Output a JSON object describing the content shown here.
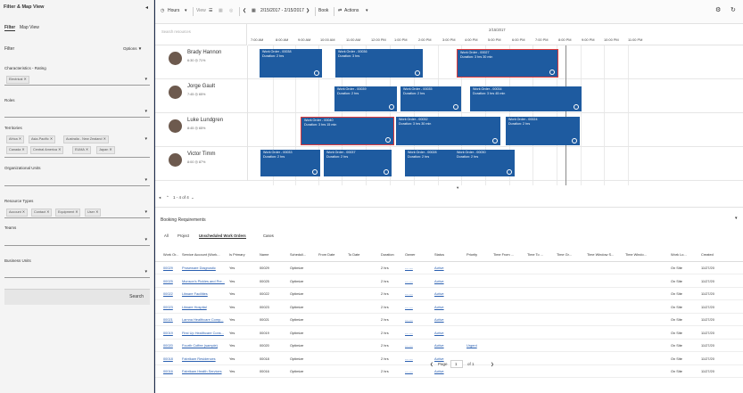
{
  "left_panel": {
    "title": "Filter & Map View",
    "collapse_icon": "chevron-left-icon",
    "tabs": [
      "Filter",
      "Map View"
    ],
    "filter_heading": "Filter",
    "options_label": "Options ▼",
    "characteristics_label": "Characteristics - Rating",
    "characteristics_chips": [
      "Electrical ✕"
    ],
    "roles_label": "Roles",
    "territories_label": "Territories",
    "territories_chips_row1": [
      "Africa ✕",
      "Asia-Pacific ✕",
      "Australia - New Zealand ✕"
    ],
    "territories_chips_row2": [
      "Canada ✕",
      "Central America ✕",
      "EUMA ✕",
      "Japan ✕"
    ],
    "org_units_label": "Organizational Units",
    "resource_types_label": "Resource Types",
    "resource_types_chips": [
      "Account ✕",
      "Contact ✕",
      "Equipment ✕",
      "User ✕"
    ],
    "teams_label": "Teams",
    "business_units_label": "Business Units",
    "search_button": "Search"
  },
  "toolbar": {
    "hours_label": "Hours",
    "view_label": "View",
    "date_range": "2/15/2017 - 2/15/2017",
    "book_label": "Book",
    "actions_label": "Actions"
  },
  "schedule": {
    "search_placeholder": "Search resources",
    "date": "2/15/2017",
    "hours": [
      "7:00 AM",
      "8:00 AM",
      "9:00 AM",
      "10:00 AM",
      "11:00 AM",
      "12:00 PM",
      "1:00 PM",
      "2:00 PM",
      "3:00 PM",
      "4:00 PM",
      "5:00 PM",
      "6:00 PM",
      "7:00 PM",
      "8:00 PM",
      "9:00 PM",
      "10:00 PM",
      "11:00 PM"
    ],
    "resources": [
      {
        "name": "Brady Hannon",
        "sub": "6:30 ◎    71%"
      },
      {
        "name": "Jorge Gault",
        "sub": "7:45 ◎    65%"
      },
      {
        "name": "Luke Lundgren",
        "sub": "8:45 ◎    65%"
      },
      {
        "name": "Victor Timm",
        "sub": "8:00 ◎    87%"
      }
    ],
    "bookings": [
      {
        "row": 0,
        "title": "Work Order - 00038",
        "dur": "Duration: 2 hrs"
      },
      {
        "row": 0,
        "title": "Work Order - 00036",
        "dur": "Duration: 3 hrs"
      },
      {
        "row": 0,
        "title": "Work Order - 00027",
        "dur": "Duration: 3 hrs 30 min"
      },
      {
        "row": 1,
        "title": "Work Order - 00039",
        "dur": "Duration: 2 hrs"
      },
      {
        "row": 1,
        "title": "Work Order - 00035",
        "dur": "Duration: 2 hrs"
      },
      {
        "row": 1,
        "title": "Work Order - 00034",
        "dur": "Duration: 3 hrs 45 min"
      },
      {
        "row": 2,
        "title": "Work Order - 00040",
        "dur": "Duration: 3 hrs 15 min"
      },
      {
        "row": 2,
        "title": "Work Order - 00032",
        "dur": "Duration: 3 hrs 30 min"
      },
      {
        "row": 2,
        "title": "Work Order - 00024",
        "dur": "Duration: 2 hrs"
      },
      {
        "row": 3,
        "title": "Work Order - 00033",
        "dur": "Duration: 2 hrs"
      },
      {
        "row": 3,
        "title": "Work Order - 00037",
        "dur": "Duration: 2 hrs"
      },
      {
        "row": 3,
        "title": "Work Order - 00028",
        "dur": "Duration: 2 hrs"
      },
      {
        "row": 3,
        "title": "Work Order - 00030",
        "dur": "Duration: 2 hrs"
      }
    ],
    "pager": "1 - 4 of 4"
  },
  "requirements": {
    "title": "Booking Requirements",
    "tabs": [
      "All",
      "Project",
      "Unscheduled Work Orders",
      "Cases"
    ],
    "columns": [
      "Work Or...",
      "Service Account (Work...",
      "Is Primary",
      "Name",
      "Scheduli...",
      "From Date",
      "To Date",
      "Duration",
      "Owner",
      "Status",
      "Priority",
      "Time From ...",
      "Time To ...",
      "Time Gr...",
      "Time Window S...",
      "Time Windo...",
      "Work Lo...",
      "Created"
    ],
    "rows": [
      [
        "00029",
        "Proseware Diagnostic",
        "Yes",
        "00029",
        "Optimize",
        "2 hrs",
        "--- ---",
        "Active",
        "",
        "On Site",
        "11/27/20"
      ],
      [
        "00025",
        "Munson's Pickles and Pre...",
        "Yes",
        "00025",
        "Optimize",
        "2 hrs",
        "--- ---",
        "Active",
        "",
        "On Site",
        "11/27/20"
      ],
      [
        "00022",
        "Litware Facilities",
        "Yes",
        "00022",
        "Optimize",
        "2 hrs",
        "--- ---",
        "Active",
        "",
        "On Site",
        "11/27/20"
      ],
      [
        "00023",
        "Litware Hospital",
        "Yes",
        "00023",
        "Optimize",
        "2 hrs",
        "--- ---",
        "Active",
        "",
        "On Site",
        "11/27/20"
      ],
      [
        "00021",
        "Lamna Healthcare Comp...",
        "Yes",
        "00021",
        "Optimize",
        "2 hrs",
        "--- ---",
        "Active",
        "",
        "On Site",
        "11/27/20"
      ],
      [
        "00019",
        "First Up Healthcare Cons...",
        "Yes",
        "00019",
        "Optimize",
        "2 hrs",
        "--- ---",
        "Active",
        "",
        "On Site",
        "11/27/20"
      ],
      [
        "00020",
        "Fourth Coffee (sample)",
        "Yes",
        "00020",
        "Optimize",
        "2 hrs",
        "--- ---",
        "Active",
        "Urgent",
        "On Site",
        "11/27/20"
      ],
      [
        "00018",
        "Fabrikam Residences",
        "Yes",
        "00018",
        "Optimize",
        "2 hrs",
        "--- ---",
        "Active",
        "",
        "On Site",
        "11/27/20"
      ],
      [
        "00016",
        "Fabrikam Health Services",
        "Yes",
        "00016",
        "Optimize",
        "2 hrs",
        "--- ---",
        "Active",
        "",
        "On Site",
        "11/27/20"
      ]
    ],
    "page_label": "Page",
    "page_value": "1",
    "page_of": "of 1"
  }
}
